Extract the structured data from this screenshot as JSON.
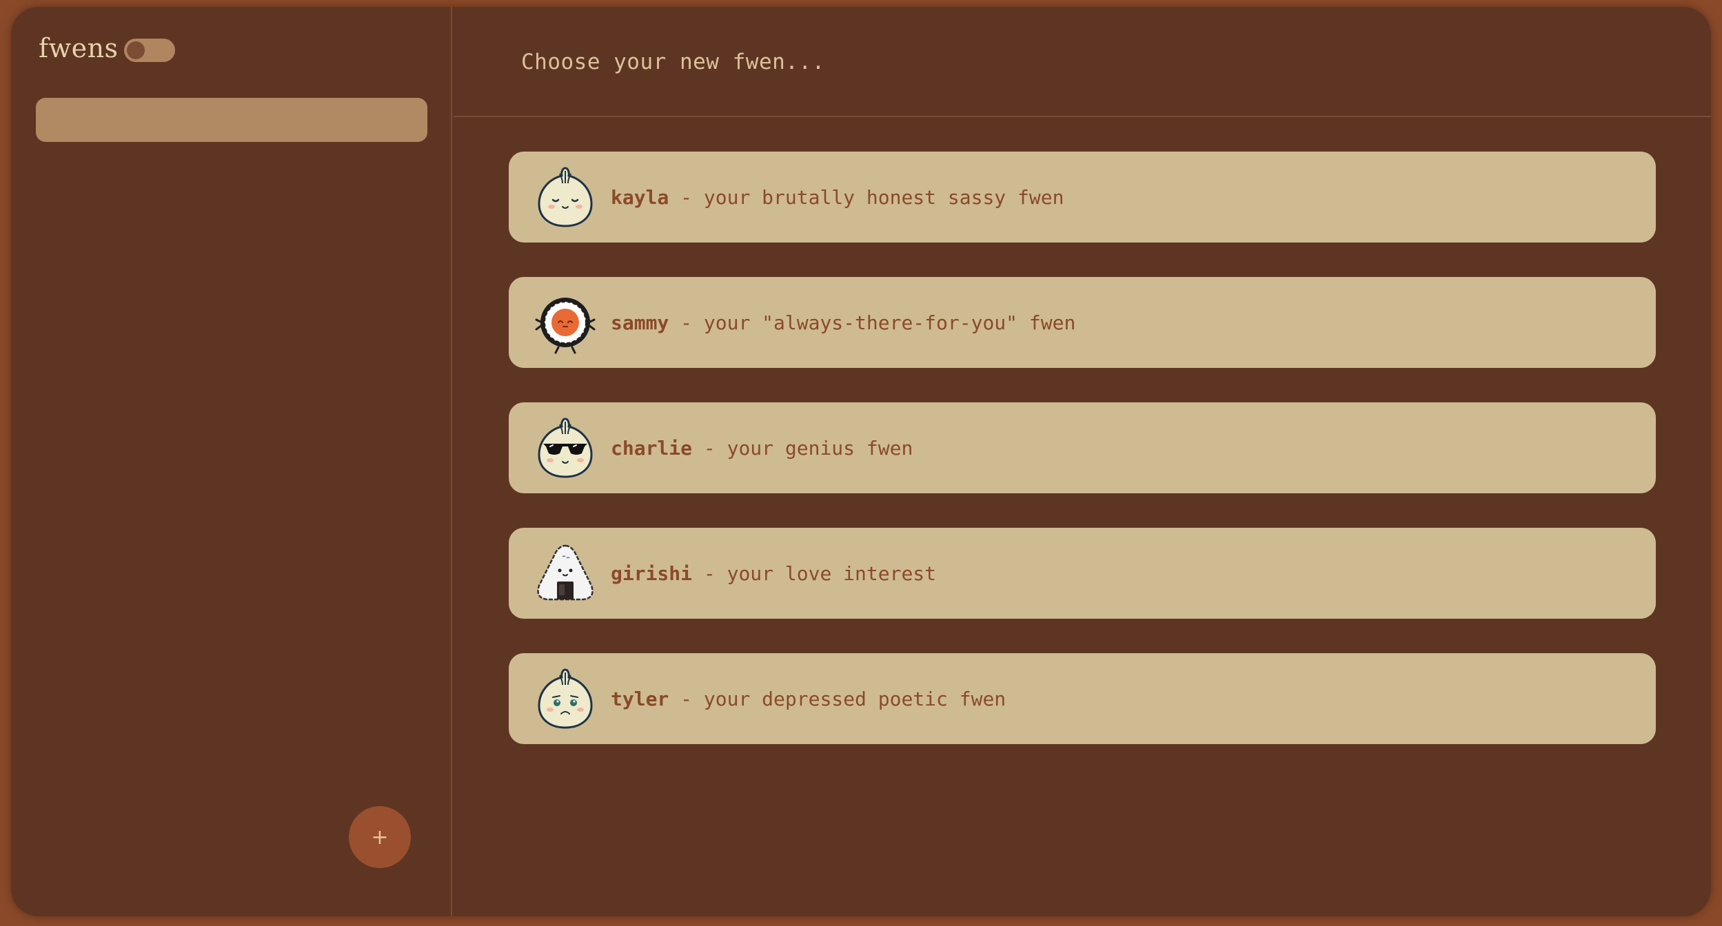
{
  "sidebar": {
    "brand": "fwens",
    "toggle_on": false,
    "search_value": "",
    "add_button_label": "+"
  },
  "header": {
    "title": "Choose your new fwen..."
  },
  "fwens": [
    {
      "name": "kayla",
      "desc": " - your brutally honest sassy fwen",
      "icon": "sassy-bun-icon"
    },
    {
      "name": "sammy",
      "desc": " - your \"always-there-for-you\" fwen",
      "icon": "sushi-roll-icon"
    },
    {
      "name": "charlie",
      "desc": " - your genius fwen",
      "icon": "sunglasses-bun-icon"
    },
    {
      "name": "girishi",
      "desc": " - your love interest",
      "icon": "onigiri-icon"
    },
    {
      "name": "tyler",
      "desc": " - your depressed poetic fwen",
      "icon": "sad-bun-icon"
    }
  ],
  "colors": {
    "window_bg": "#5e3522",
    "outer_bg": "#8a4a2a",
    "card_bg": "#cfbb92",
    "card_text": "#8a4a2a",
    "accent": "#9a4f2e"
  }
}
